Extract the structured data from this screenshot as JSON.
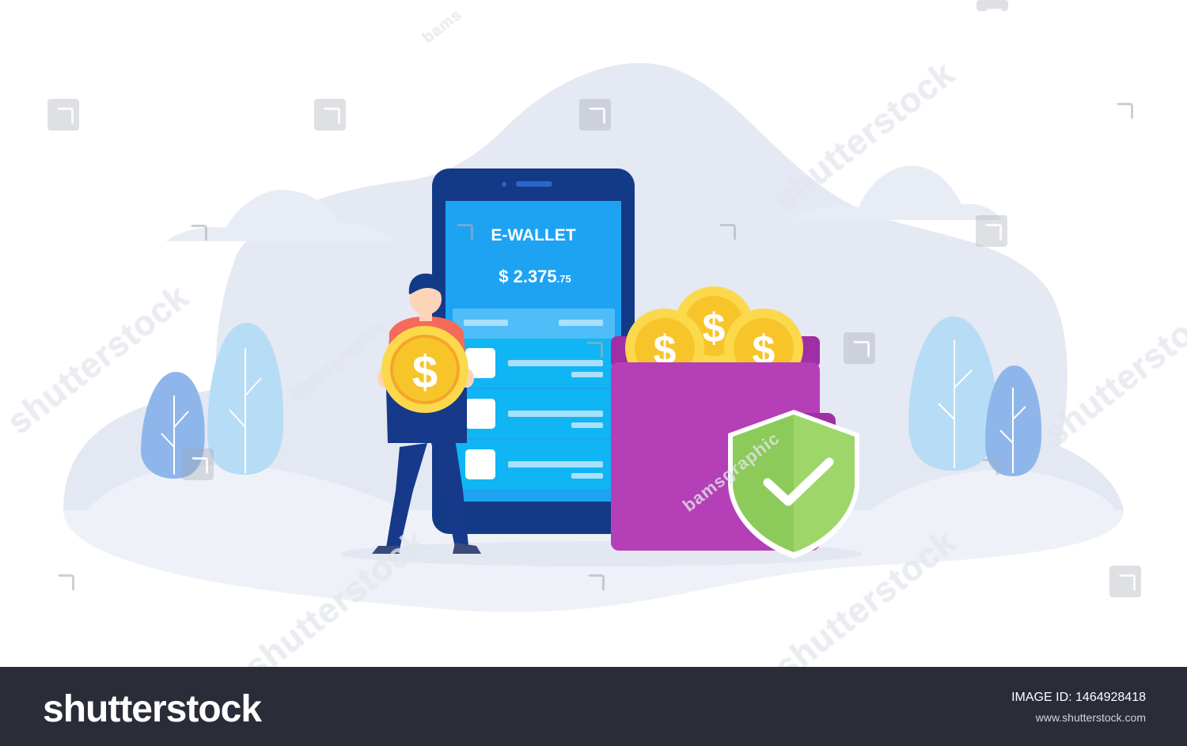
{
  "screen": {
    "title": "E-WALLET",
    "balance_main": "$ 2.375",
    "balance_cents": ".75"
  },
  "coin_symbol": "$",
  "watermarks": {
    "shutterstock": "shutterstock",
    "bamsgraphic": "bamsgraphic",
    "bams_partial": "bams"
  },
  "footer": {
    "logo": "shutterstock",
    "image_id_label": "IMAGE ID:",
    "image_id_value": "1464928418",
    "url": "www.shutterstock.com"
  },
  "colors": {
    "phone_body": "#133a87",
    "screen": "#1ea3f3",
    "wallet": "#b53fb7",
    "coin": "#f7c52a",
    "shield": "#8ccb5a",
    "person_shirt": "#f46b5c",
    "person_pants": "#16398a",
    "footer_bg": "#2a2d37"
  },
  "icons": [
    "dollar-coin-icon",
    "shield-check-icon"
  ]
}
